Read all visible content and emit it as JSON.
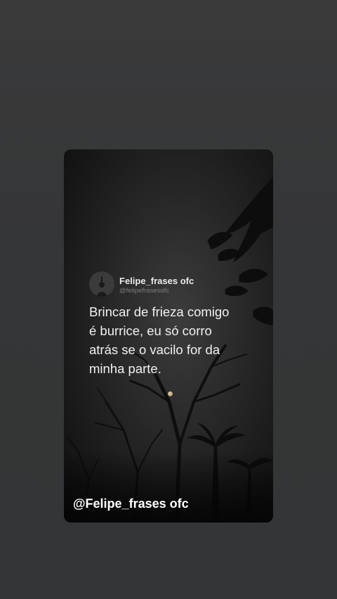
{
  "post": {
    "author_name": "Felipe_frases ofc",
    "author_handle": "@felipefrasesofc",
    "quote_lines": [
      "Brincar de frieza comigo",
      "é burrice, eu só corro",
      "atrás se o vacilo for da",
      "minha parte."
    ],
    "avatar_icon": "avatar-silhouette-icon"
  },
  "watermark": {
    "text": "@Felipe_frases ofc"
  },
  "colors": {
    "page_background": "#363738",
    "card_background": "#1a1a1a",
    "text_primary": "#f1f1f1",
    "text_secondary": "#7d7d7d"
  }
}
